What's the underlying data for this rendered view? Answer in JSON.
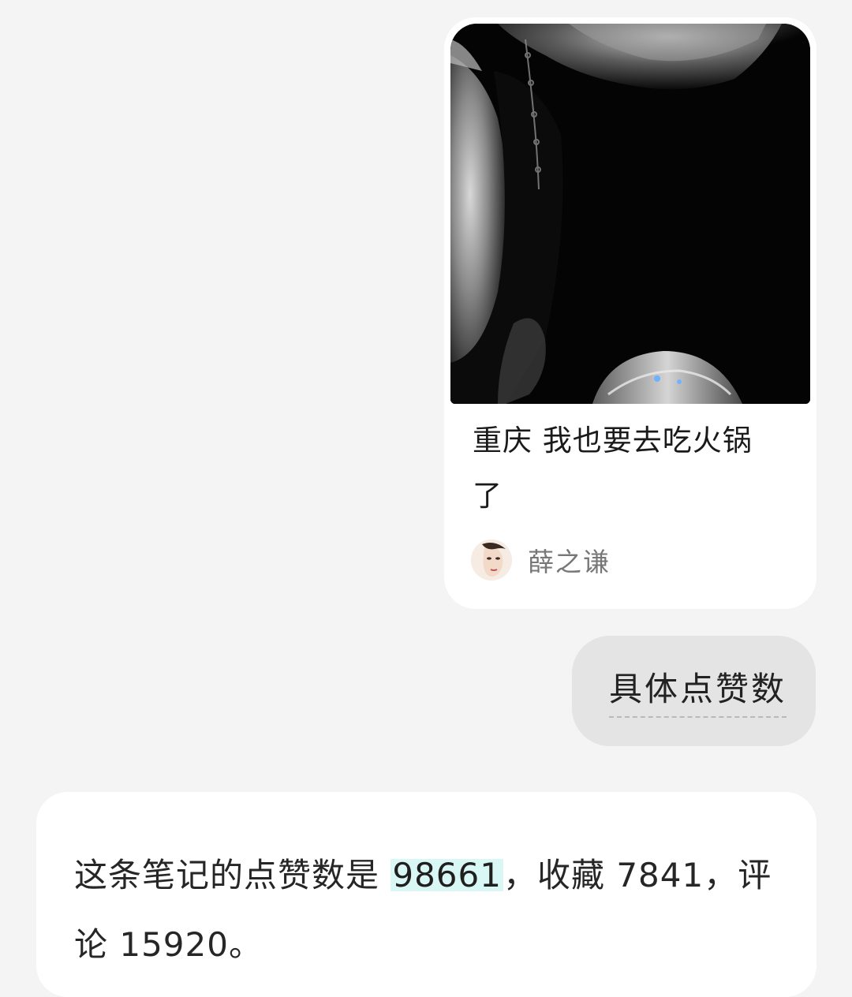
{
  "note_card": {
    "title_line1": "重庆 我也要去吃火锅",
    "title_line2": "了",
    "author": "薛之谦",
    "cover_icon": "cover-photo",
    "avatar_icon": "avatar-photo"
  },
  "user_message": {
    "text": "具体点赞数"
  },
  "answer": {
    "prefix": "这条笔记的点赞数是 ",
    "likes": "98661",
    "middle": "，收藏 7841，评",
    "line2": "论 15920。"
  },
  "colors": {
    "page_bg": "#f4f4f4",
    "card_bg": "#ffffff",
    "user_bubble_bg": "#e4e4e4",
    "highlight_bg": "#d9f8f5",
    "author_text": "#777777"
  }
}
